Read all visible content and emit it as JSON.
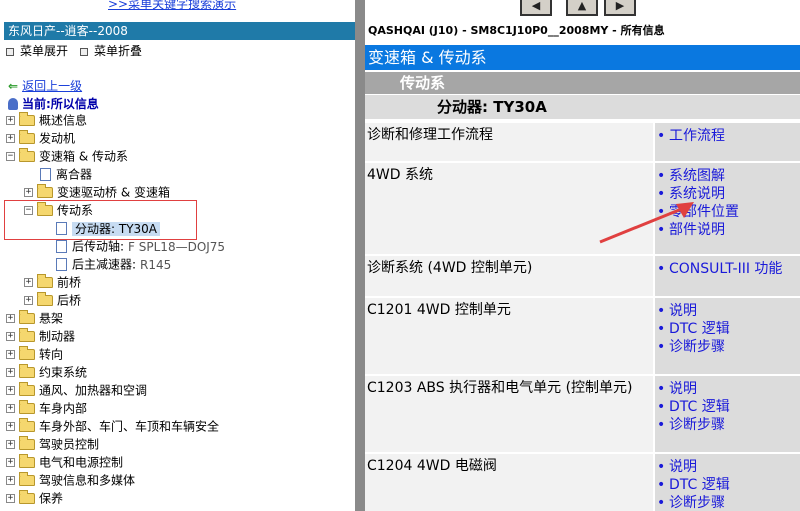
{
  "top": {
    "search_link": ">>菜单关键字搜索演示"
  },
  "left": {
    "title": "东风日产--逍客--2008",
    "expand_label": "菜单展开",
    "collapse_label": "菜单折叠",
    "back_label": "返回上一级",
    "current_label": "当前:所以信息",
    "tree": [
      {
        "label": "概述信息",
        "pm": "+"
      },
      {
        "label": "发动机",
        "pm": "+"
      },
      {
        "label": "变速箱 & 传动系",
        "pm": "−"
      },
      {
        "label": "离合器"
      },
      {
        "label": "变速驱动桥 & 变速箱",
        "pm": "+"
      },
      {
        "label": "传动系",
        "pm": "−"
      },
      {
        "label": "分动器: TY30A"
      },
      {
        "label": "后传动轴:",
        "extra": "F SPL18—DOJ75"
      },
      {
        "label": "后主减速器:",
        "extra": "R145"
      },
      {
        "label": "前桥",
        "pm": "+"
      },
      {
        "label": "后桥",
        "pm": "+"
      },
      {
        "label": "悬架",
        "pm": "+"
      },
      {
        "label": "制动器",
        "pm": "+"
      },
      {
        "label": "转向",
        "pm": "+"
      },
      {
        "label": "约束系统",
        "pm": "+"
      },
      {
        "label": "通风、加热器和空调",
        "pm": "+"
      },
      {
        "label": "车身内部",
        "pm": "+"
      },
      {
        "label": "车身外部、车门、车顶和车辆安全",
        "pm": "+"
      },
      {
        "label": "驾驶员控制",
        "pm": "+"
      },
      {
        "label": "电气和电源控制",
        "pm": "+"
      },
      {
        "label": "驾驶信息和多媒体",
        "pm": "+"
      },
      {
        "label": "保养",
        "pm": "+"
      }
    ]
  },
  "right": {
    "header": "QASHQAI (J10) - SM8C1J10P0__2008MY - 所有信息",
    "title": "变速箱 & 传动系",
    "subtitle": "传动系",
    "section": "分动器: TY30A",
    "rows": [
      {
        "label": "诊断和修理工作流程",
        "links": [
          "工作流程"
        ]
      },
      {
        "label": "4WD 系统",
        "links": [
          "系统图解",
          "系统说明",
          "零部件位置",
          "部件说明"
        ]
      },
      {
        "label": "诊断系统 (4WD 控制单元)",
        "links": [
          "CONSULT-III 功能"
        ]
      },
      {
        "label": "C1201 4WD 控制单元",
        "links": [
          "说明",
          "DTC 逻辑",
          "诊断步骤"
        ]
      },
      {
        "label": "C1203 ABS 执行器和电气单元 (控制单元)",
        "links": [
          "说明",
          "DTC 逻辑",
          "诊断步骤"
        ]
      },
      {
        "label": "C1204 4WD 电磁阀",
        "links": [
          "说明",
          "DTC 逻辑",
          "诊断步骤"
        ]
      }
    ]
  },
  "colors": {
    "accent_blue": "#0a78e0",
    "left_title_bg": "#1f7aa8",
    "annotation_red": "#e04040"
  }
}
